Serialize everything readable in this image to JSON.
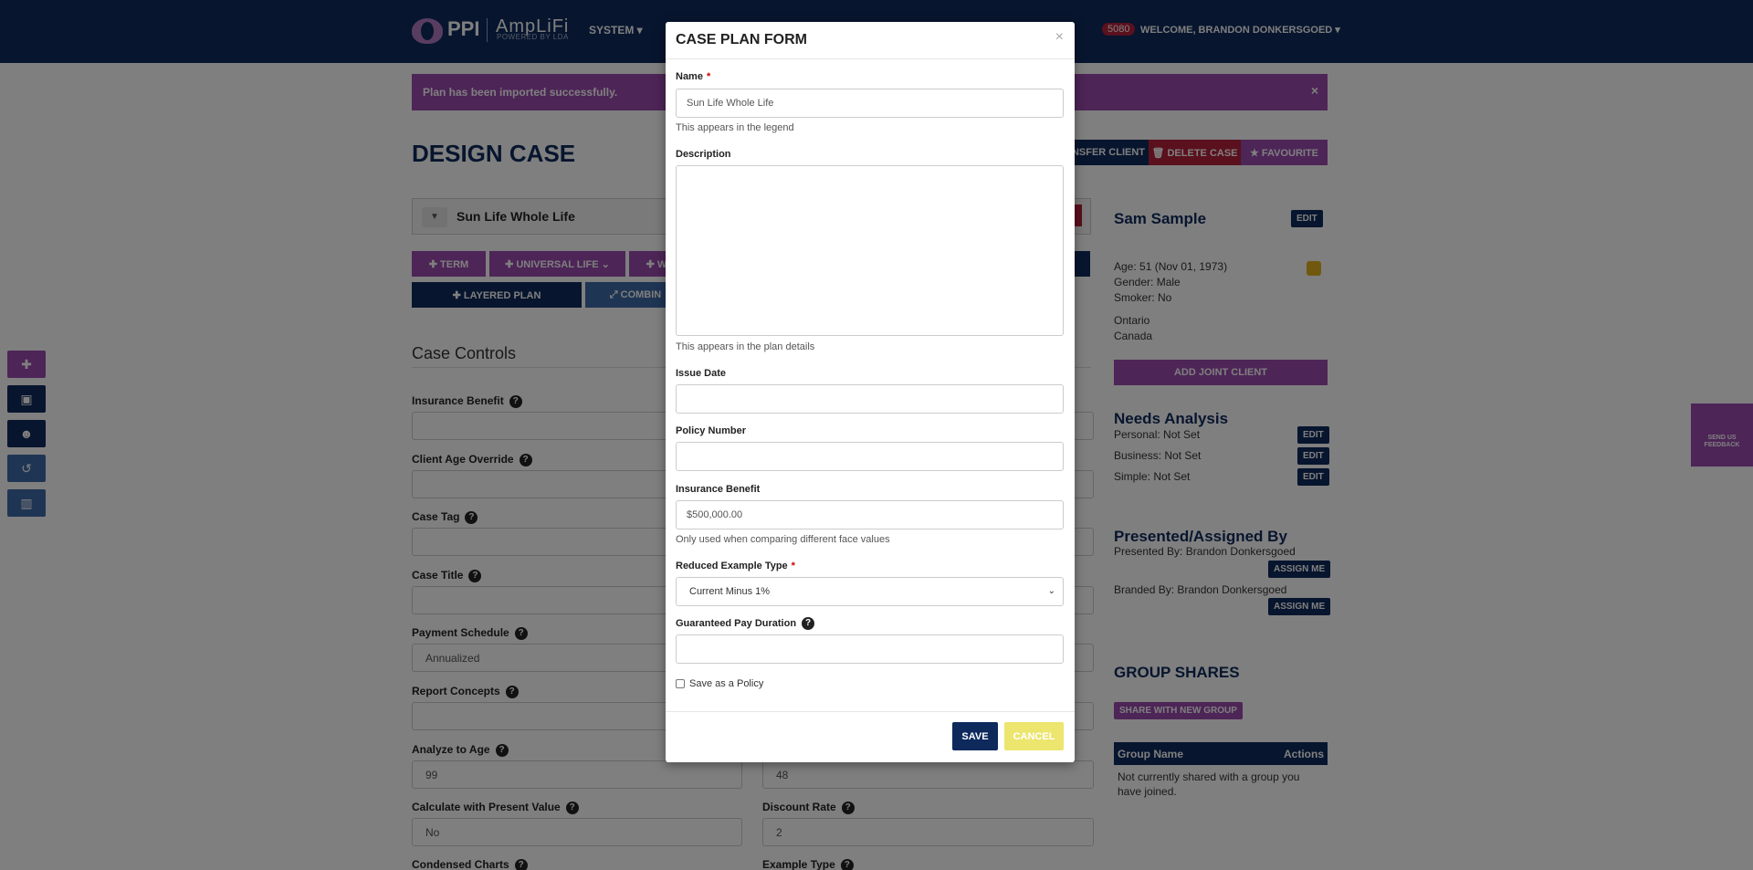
{
  "navbar": {
    "logo_ppi": "PPI",
    "logo_amplifi": "AmpLiFi",
    "logo_powered": "POWERED BY LDA",
    "system_menu": "SYSTEM ▾",
    "badge_count": "5080",
    "welcome": "WELCOME, BRANDON DONKERSGOED ▾"
  },
  "alert": {
    "message": "Plan has been imported successfully.",
    "close": "×"
  },
  "page": {
    "title": "DESIGN CASE",
    "transfer_client": "NSFER CLIENT",
    "delete_case": "🗑 DELETE CASE",
    "favourite": "★ FAVOURITE",
    "plan_name": "Sun Life Whole Life",
    "term_btn": "✚ TERM",
    "universal_life_btn": "✚ UNIVERSAL LIFE ⌄",
    "whole_btn": "✚ W",
    "layered_plan_btn": "✚ LAYERED PLAN",
    "combine_btn": "⤢ COMBIN",
    "case_controls": "Case Controls",
    "fields": {
      "insurance_benefit": "Insurance Benefit",
      "client_age_override": "Client Age Override",
      "case_tag": "Case Tag",
      "case_title": "Case Title",
      "payment_schedule": "Payment Schedule",
      "payment_schedule_value": "Annualized",
      "report_concepts": "Report Concepts",
      "analyze_to_age": "Analyze to Age",
      "analyze_to_age_value": "99",
      "right_value_48": "48",
      "calc_present_value": "Calculate with Present Value",
      "calc_present_value_value": "No",
      "discount_rate": "Discount Rate",
      "discount_rate_value": "2",
      "condensed_charts": "Condensed Charts",
      "example_type": "Example Type"
    }
  },
  "sidebar": {
    "client_name": "Sam Sample",
    "edit": "EDIT",
    "age": "Age: 51 (Nov 01, 1973)",
    "gender": "Gender: Male",
    "smoker": "Smoker: No",
    "province": "Ontario",
    "country": "Canada",
    "add_joint_client": "ADD JOINT CLIENT",
    "needs_analysis": "Needs Analysis",
    "personal": "Personal: Not Set",
    "business": "Business: Not Set",
    "simple": "Simple: Not Set",
    "presented_assigned": "Presented/Assigned By",
    "presented_by": "Presented By: Brandon Donkersgoed",
    "branded_by": "Branded By: Brandon Donkersgoed",
    "assign_me": "ASSIGN ME",
    "group_shares": "GROUP SHARES",
    "share_new_group": "SHARE WITH NEW GROUP",
    "group_name_col": "Group Name",
    "actions_col": "Actions",
    "no_groups": "Not currently shared with a group you have joined."
  },
  "feedback": {
    "label_line1": "SEND US",
    "label_line2": "FEEDBACK"
  },
  "modal": {
    "title": "CASE PLAN FORM",
    "close": "×",
    "name_label": "Name",
    "required_mark": "*",
    "name_value": "Sun Life Whole Life",
    "name_help": "This appears in the legend",
    "description_label": "Description",
    "description_help": "This appears in the plan details",
    "issue_date_label": "Issue Date",
    "policy_number_label": "Policy Number",
    "insurance_benefit_label": "Insurance Benefit",
    "insurance_benefit_value": "$500,000.00",
    "insurance_benefit_help": "Only used when comparing different face values",
    "reduced_example_label": "Reduced Example Type",
    "reduced_example_value": "Current Minus 1%",
    "guaranteed_pay_label": "Guaranteed Pay Duration",
    "save_as_policy": "Save as a Policy",
    "save": "SAVE",
    "cancel": "CANCEL"
  },
  "colors": {
    "navy": "#0e2a5c",
    "purple": "#9b4bae",
    "red": "#b5203b",
    "yellow": "#ece56e"
  }
}
